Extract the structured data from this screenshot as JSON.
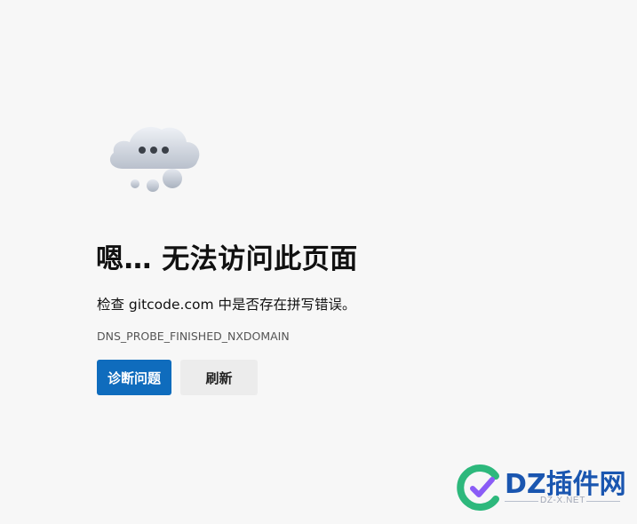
{
  "page": {
    "title": "嗯… 无法访问此页面",
    "description": "检查 gitcode.com 中是否存在拼写错误。",
    "error_code": "DNS_PROBE_FINISHED_NXDOMAIN",
    "illustration": "cloud-ellipsis-icon"
  },
  "buttons": {
    "diagnose_label": "诊断问题",
    "refresh_label": "刷新"
  },
  "colors": {
    "background": "#f7f7f7",
    "primary_button": "#0f6cbd",
    "secondary_button": "#ececec",
    "error_code_text": "#555555"
  },
  "watermark": {
    "text": "DZ插件网",
    "subtext": "DZ-X.NET",
    "icon": "dz-logo-icon"
  }
}
